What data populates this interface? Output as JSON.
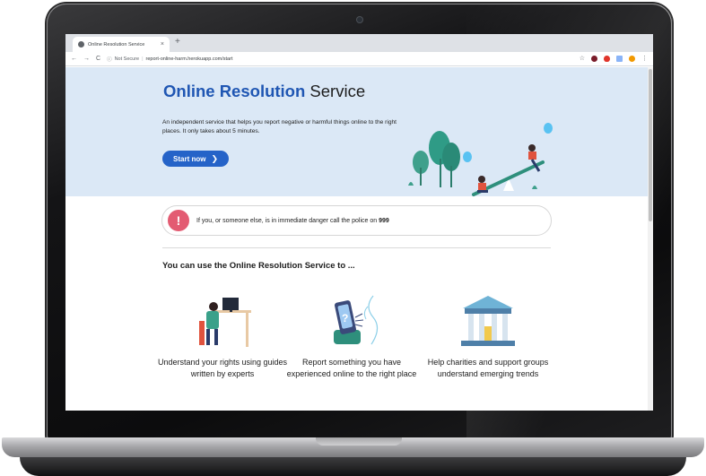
{
  "browser": {
    "tab_title": "Online Resolution Service",
    "tab_close": "×",
    "new_tab": "+",
    "nav": {
      "back": "←",
      "forward": "→",
      "reload": "C"
    },
    "security_label": "Not Secure",
    "url": "report-online-harm.herokuapp.com/start",
    "extensions": [
      "star-icon",
      "ublock-icon",
      "opera-icon",
      "cast-icon",
      "profile-avatar",
      "menu-icon"
    ],
    "menu": "⋮"
  },
  "hero": {
    "title_bold": "Online Resolution",
    "title_light": "Service",
    "description": "An independent service that helps you report negative or harmful things online to the right places. It only takes about 5 minutes.",
    "start_label": "Start now",
    "start_icon": "chevron-right-icon"
  },
  "alert": {
    "icon": "!",
    "text_prefix": "If you, or someone else, is in immediate danger call the police on ",
    "number": "999"
  },
  "section_title": "You can use the Online Resolution Service to ...",
  "features": [
    {
      "icon": "person-at-computer-illustration",
      "text": "Understand your rights using guides written by experts"
    },
    {
      "icon": "phone-report-illustration",
      "text": "Report something you have experienced online to the right place"
    },
    {
      "icon": "institution-building-illustration",
      "text": "Help charities and support groups understand emerging trends"
    }
  ],
  "colors": {
    "brand_blue": "#1f56b3",
    "button_blue": "#2563c8",
    "hero_bg": "#dbe8f6",
    "alert_red": "#e35b72"
  }
}
